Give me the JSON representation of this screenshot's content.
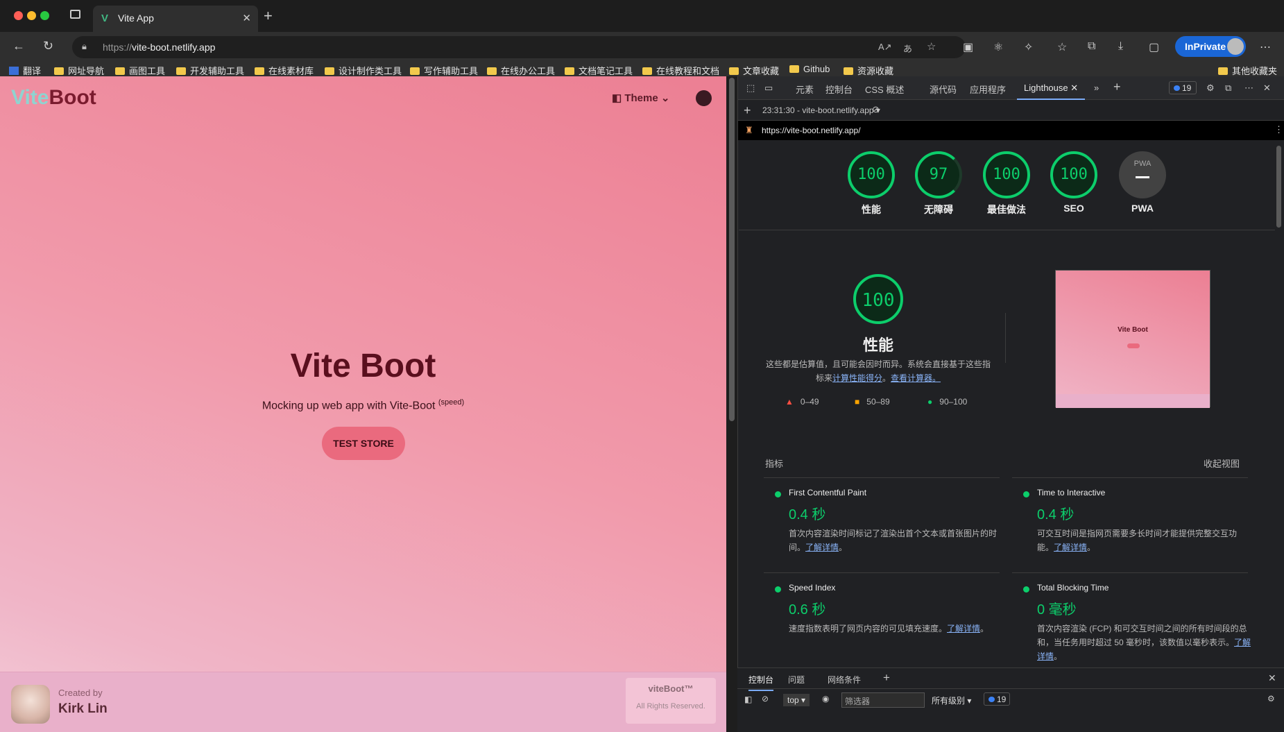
{
  "browser": {
    "tab_title": "Vite App",
    "url_prefix": "https://",
    "url_host": "vite-boot.netlify.app",
    "inprivate_label": "InPrivate"
  },
  "bookmarks": [
    "翻译",
    "网址导航",
    "画图工具",
    "开发辅助工具",
    "在线素材库",
    "设计制作类工具",
    "写作辅助工具",
    "在线办公工具",
    "文档笔记工具",
    "在线教程和文档",
    "文章收藏",
    "Github",
    "资源收藏"
  ],
  "bookmarks_other": "其他收藏夹",
  "page": {
    "logo_vite": "Vite",
    "logo_boot": "Boot",
    "theme_label": "Theme",
    "hero_title": "Vite Boot",
    "hero_sub": "Mocking up web app with Vite-Boot",
    "hero_sup": "(speed)",
    "cta": "TEST STORE",
    "created_by": "Created by",
    "author": "Kirk Lin",
    "brand": "viteBoot™",
    "rights": "All Rights Reserved."
  },
  "devtools": {
    "tabs": [
      "元素",
      "控制台",
      "CSS 概述",
      "源代码",
      "应用程序"
    ],
    "active_tab": "Lighthouse",
    "issues_count": "19",
    "report_select": "23:31:30 - vite-boot.netlify.app",
    "report_url": "https://vite-boot.netlify.app/",
    "scores": [
      {
        "value": "100",
        "label": "性能"
      },
      {
        "value": "97",
        "label": "无障碍"
      },
      {
        "value": "100",
        "label": "最佳做法"
      },
      {
        "value": "100",
        "label": "SEO"
      }
    ],
    "pwa_label": "PWA",
    "pwa_badge": "PWA",
    "perf_score": "100",
    "perf_title": "性能",
    "perf_desc": "这些都是估算值，且可能会因时而异。系统会直接基于这些指标来",
    "perf_link1": "计算性能得分",
    "perf_link_sep": "。",
    "perf_link2": "查看计算器。",
    "legend": [
      "0–49",
      "50–89",
      "90–100"
    ],
    "screenshot_title": "Vite Boot",
    "metrics_heading": "指标",
    "view_toggle": "收起视图",
    "metrics": [
      {
        "name": "First Contentful Paint",
        "value": "0.4 秒",
        "desc": "首次内容渲染时间标记了渲染出首个文本或首张图片的时间。",
        "link": "了解详情"
      },
      {
        "name": "Time to Interactive",
        "value": "0.4 秒",
        "desc": "可交互时间是指网页需要多长时间才能提供完整交互功能。",
        "link": "了解详情"
      },
      {
        "name": "Speed Index",
        "value": "0.6 秒",
        "desc": "速度指数表明了网页内容的可见填充速度。",
        "link": "了解详情"
      },
      {
        "name": "Total Blocking Time",
        "value": "0 毫秒",
        "desc": "首次内容渲染 (FCP) 和可交互时间之间的所有时间段的总和，当任务用时超过 50 毫秒时，该数值以毫秒表示。",
        "link": "了解详情"
      }
    ]
  },
  "console": {
    "tabs": [
      "控制台",
      "问题",
      "网络条件"
    ],
    "context": "top",
    "filter_placeholder": "筛选器",
    "levels": "所有级别",
    "count": "19"
  }
}
